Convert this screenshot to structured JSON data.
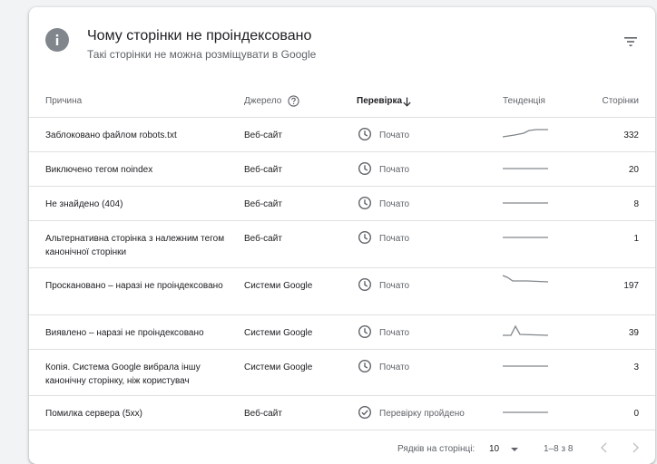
{
  "header": {
    "icon": "info-icon",
    "title": "Чому сторінки не проіндексовано",
    "subtitle": "Такі сторінки не можна розміщувати в Google",
    "filter_icon": "filter-icon"
  },
  "table": {
    "columns": {
      "reason": "Причина",
      "source": "Джерело",
      "verification": "Перевірка",
      "trend": "Тенденція",
      "pages": "Сторінки"
    },
    "sort_icon": "arrow-down-icon",
    "help_icon": "help-circle-icon",
    "rows": [
      {
        "reason": "Заблоковано файлом robots.txt",
        "source": "Веб-сайт",
        "status": "Почато",
        "status_icon": "clock-icon",
        "trend_shape": "rising",
        "pages": "332"
      },
      {
        "reason": "Виключено тегом noindex",
        "source": "Веб-сайт",
        "status": "Почато",
        "status_icon": "clock-icon",
        "trend_shape": "flat",
        "pages": "20"
      },
      {
        "reason": "Не знайдено (404)",
        "source": "Веб-сайт",
        "status": "Почато",
        "status_icon": "clock-icon",
        "trend_shape": "flat",
        "pages": "8"
      },
      {
        "reason": "Альтернативна сторінка з належним тегом канонічної сторінки",
        "source": "Веб-сайт",
        "status": "Почато",
        "status_icon": "clock-icon",
        "trend_shape": "flat",
        "pages": "1"
      },
      {
        "reason": "Проскановано – наразі не проіндексовано",
        "source": "Системи Google",
        "status": "Почато",
        "status_icon": "clock-icon",
        "trend_shape": "drop",
        "pages": "197"
      },
      {
        "reason": "Виявлено – наразі не проіндексовано",
        "source": "Системи Google",
        "status": "Почато",
        "status_icon": "clock-icon",
        "trend_shape": "spike",
        "pages": "39"
      },
      {
        "reason": "Копія. Система Google вибрала іншу канонічну сторінку, ніж користувач",
        "source": "Системи Google",
        "status": "Почато",
        "status_icon": "clock-icon",
        "trend_shape": "flat",
        "pages": "3"
      },
      {
        "reason": "Помилка сервера (5xx)",
        "source": "Веб-сайт",
        "status": "Перевірку пройдено",
        "status_icon": "check-circle-icon",
        "trend_shape": "flat",
        "pages": "0"
      }
    ]
  },
  "footer": {
    "rows_per_page_label": "Рядків на сторінці:",
    "rows_per_page_value": "10",
    "range_text": "1–8 з 8",
    "prev_icon": "chevron-left-icon",
    "next_icon": "chevron-right-icon"
  },
  "colors": {
    "trend_line": "#80868b",
    "icon_grey": "#5f6368",
    "divider": "#e0e0e0"
  }
}
